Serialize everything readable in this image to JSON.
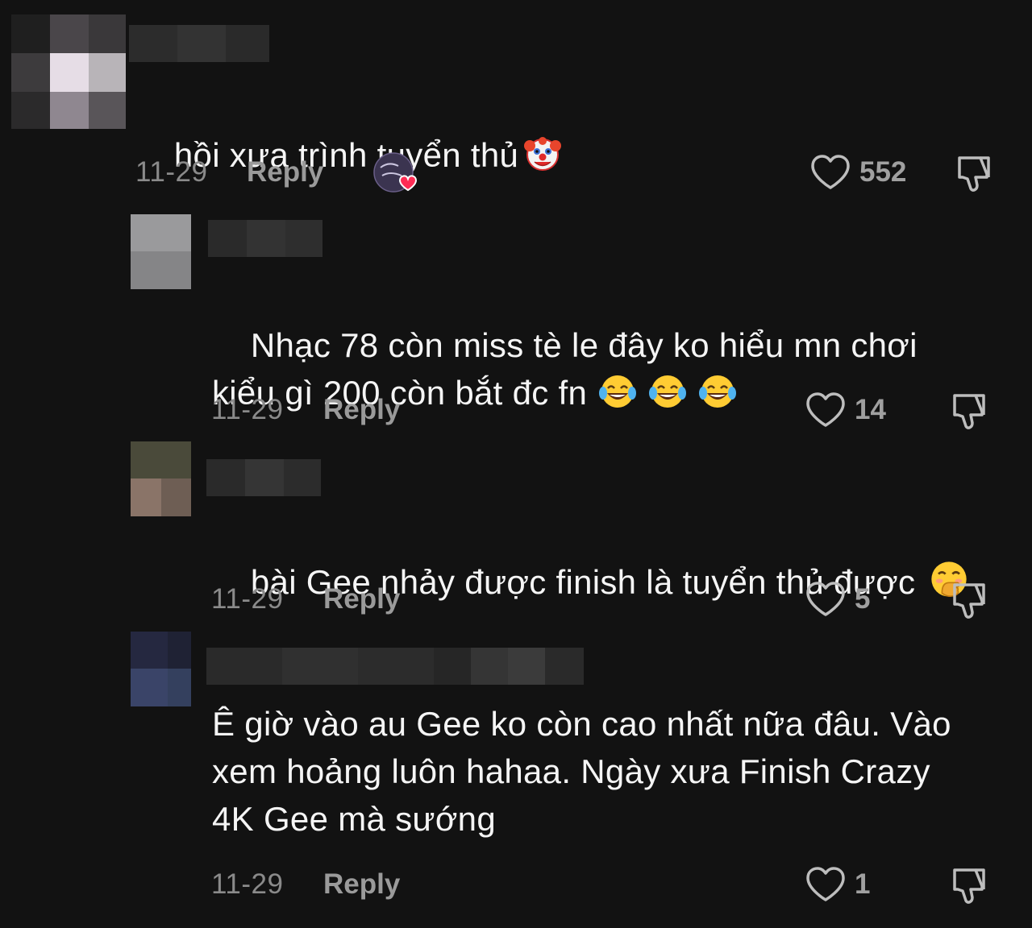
{
  "comments": [
    {
      "text": "hồi xưa trình tuyển thủ",
      "emoji": "clown-face-emoji",
      "date": "11-29",
      "reply_label": "Reply",
      "likes": "552",
      "liked_by_creator": true
    },
    {
      "text": "Nhạc 78 còn miss tè le đây ko hiểu mn chơi\nkiểu gì 200 còn bắt đc fn",
      "emoji": "tears-of-joy-emoji",
      "date": "11-29",
      "reply_label": "Reply",
      "likes": "14"
    },
    {
      "text": "bài Gee nhảy được finish là tuyển thủ được",
      "emoji": "hand-over-mouth-emoji",
      "date": "11-29",
      "reply_label": "Reply",
      "likes": "5"
    },
    {
      "text": "Ê giờ vào au Gee ko còn cao nhất nữa đâu. Vào\nxem hoảng luôn hahaa. Ngày xưa Finish Crazy\n4K Gee mà sướng",
      "date": "11-29",
      "reply_label": "Reply",
      "likes": "1"
    }
  ],
  "colors": {
    "background": "#121212",
    "text": "#f5f5f5",
    "meta": "#8a8a8a",
    "badge_heart": "#fe2c55"
  }
}
